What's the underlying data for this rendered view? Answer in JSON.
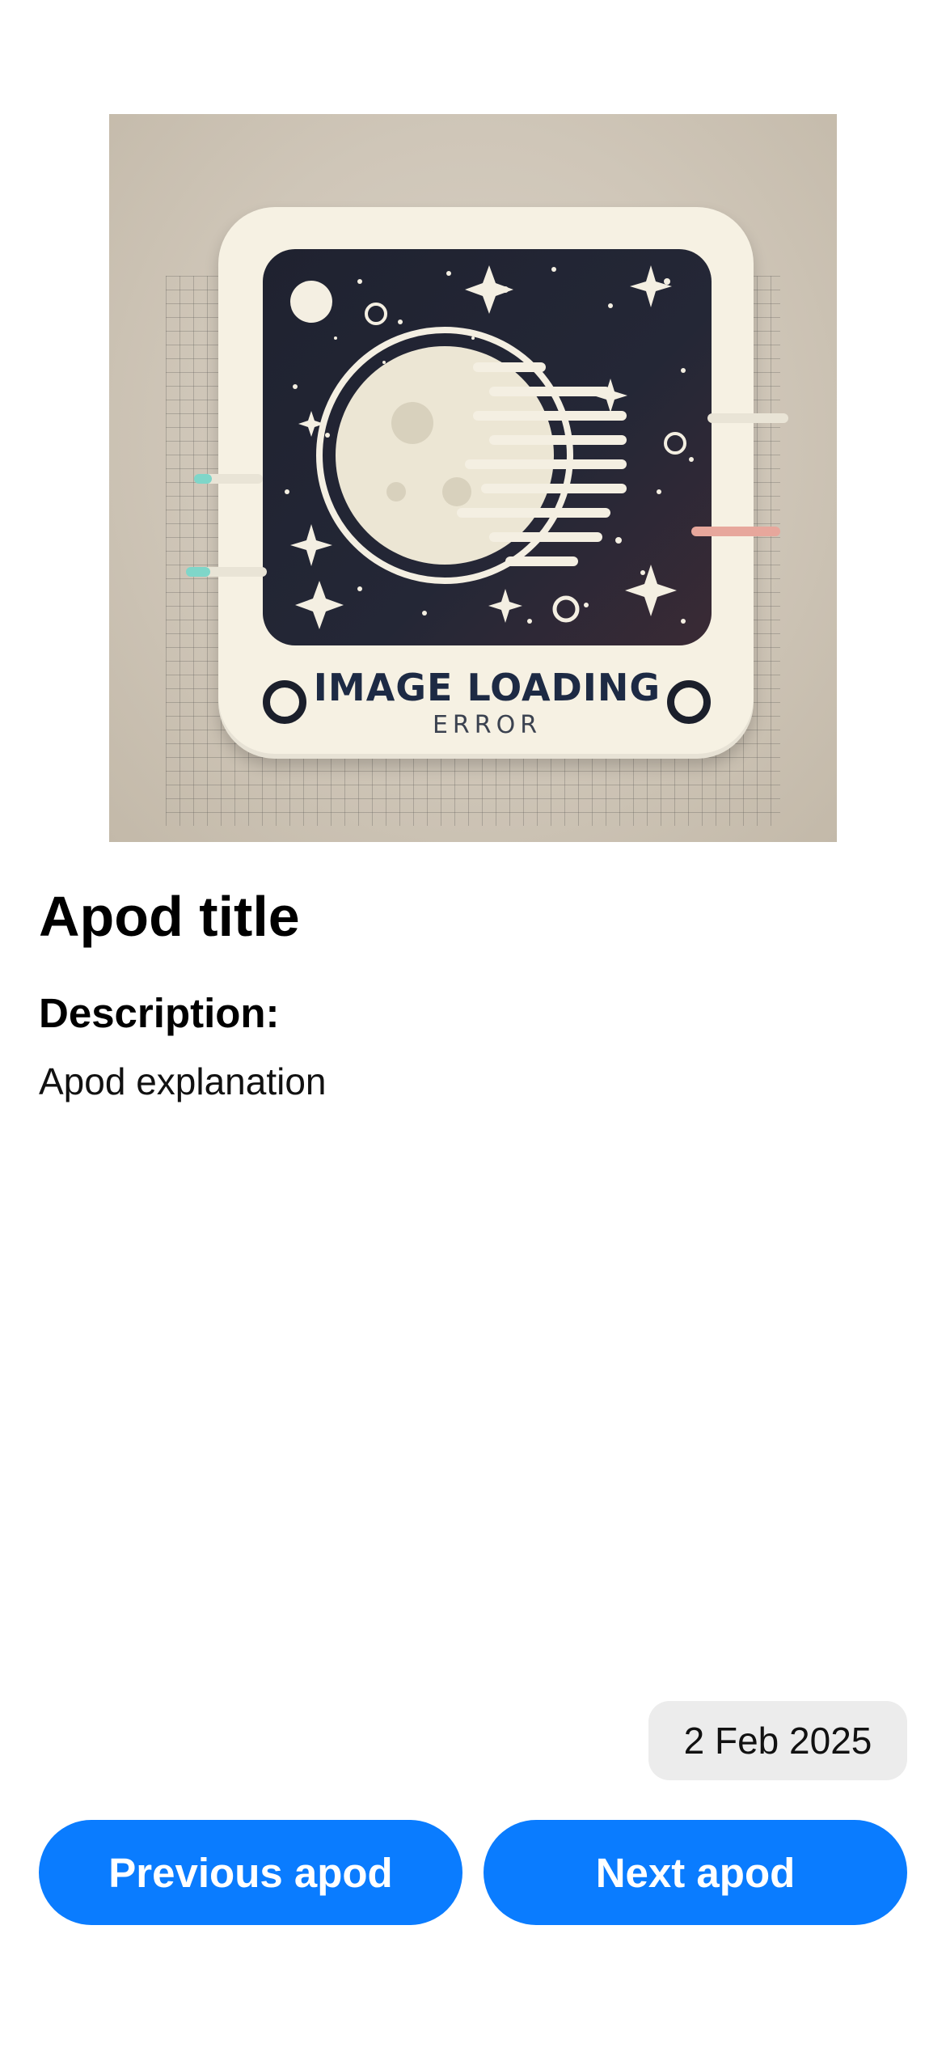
{
  "hero_image": {
    "icon": "image-loading-error-illustration",
    "caption_main": "IMAGE LOADING",
    "caption_sub": "ERROR"
  },
  "apod": {
    "title": "Apod title",
    "description_label": "Description:",
    "explanation": "Apod explanation",
    "date": "2 Feb 2025"
  },
  "actions": {
    "previous_label": "Previous apod",
    "next_label": "Next apod"
  },
  "colors": {
    "accent": "#0a7cff",
    "chip_background": "#ececec",
    "background": "#ffffff"
  }
}
